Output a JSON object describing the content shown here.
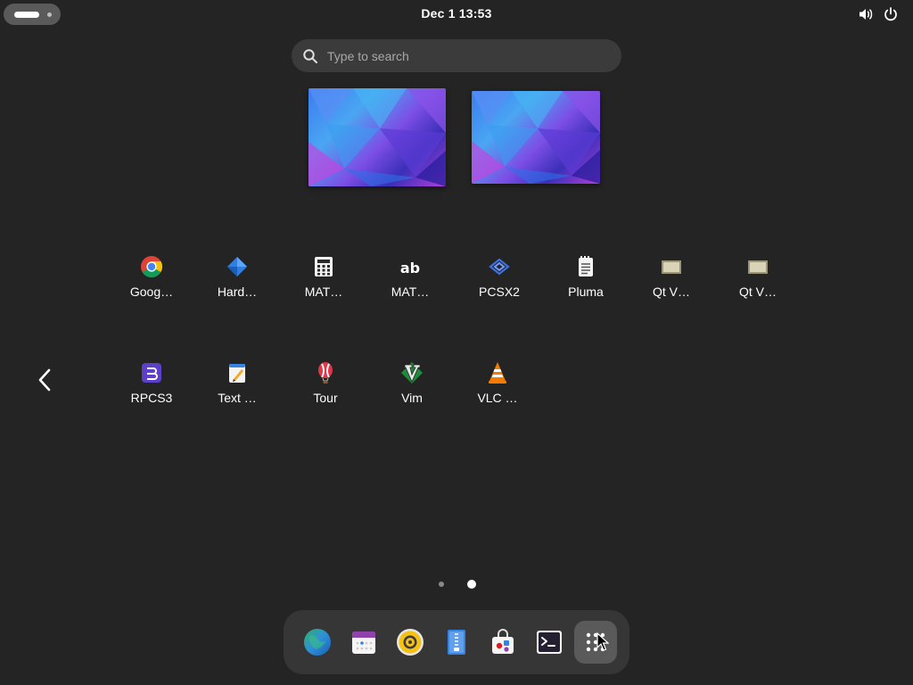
{
  "topbar": {
    "clock": "Dec 1  13:53",
    "icons": [
      "volume-icon",
      "power-icon"
    ]
  },
  "search": {
    "placeholder": "Type to search",
    "value": ""
  },
  "workspaces": [
    "workspace-1",
    "workspace-2"
  ],
  "apps": [
    {
      "label": "Goog…",
      "icon": "chrome-icon"
    },
    {
      "label": "Hard…",
      "icon": "hardinfo-icon"
    },
    {
      "label": "MAT…",
      "icon": "calculator-icon"
    },
    {
      "label": "MAT…",
      "icon": "character-map-icon"
    },
    {
      "label": "PCSX2",
      "icon": "pcsx2-icon"
    },
    {
      "label": "Pluma",
      "icon": "pluma-icon"
    },
    {
      "label": "Qt V…",
      "icon": "qt-app-icon"
    },
    {
      "label": "Qt V…",
      "icon": "qt-app-icon"
    },
    {
      "label": "RPCS3",
      "icon": "rpcs3-icon"
    },
    {
      "label": "Text …",
      "icon": "text-editor-icon"
    },
    {
      "label": "Tour",
      "icon": "tour-icon"
    },
    {
      "label": "Vim",
      "icon": "vim-icon"
    },
    {
      "label": "VLC …",
      "icon": "vlc-icon"
    }
  ],
  "pagination": {
    "pages": 2,
    "current": 2
  },
  "dock": [
    {
      "icon": "browser-icon"
    },
    {
      "icon": "calendar-icon"
    },
    {
      "icon": "music-player-icon"
    },
    {
      "icon": "document-viewer-icon"
    },
    {
      "icon": "software-store-icon"
    },
    {
      "icon": "terminal-icon"
    },
    {
      "icon": "app-grid-icon",
      "active": true
    }
  ],
  "colors": {
    "background": "#242424",
    "search_bg": "#3b3b3b",
    "dock_bg": "#363636",
    "active_item": "#5a5a5a"
  }
}
